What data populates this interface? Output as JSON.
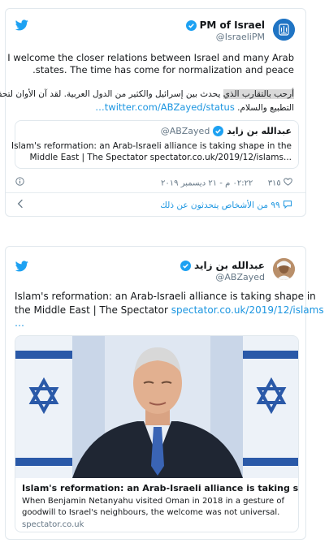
{
  "tweet1": {
    "author_name": "PM of Israel",
    "author_handle": "@IsraeliPM",
    "text_en_line1": "I welcome the closer relations between Israel and many Arab",
    "text_en_line2": ".states. The time has come for normalization and peace",
    "text_ar_line1_hl": "أرحب بالتقارب الذي",
    "text_ar_line1_rest": " يحدث بين إسرائيل والكثير من الدول العربية. لقد آن الأوان لتحقيق",
    "text_ar_line2_link": "twitter.com/ABZayed/status…",
    "text_ar_line2_rest": " التطبيع والسلام.",
    "quote": {
      "author_name": "عبدالله بن زايد",
      "author_handle": "@ABZayed",
      "text_line1": "Islam's reformation: an Arab-Israeli alliance is taking shape in the",
      "text_line2": "Middle East | The Spectator spectator.co.uk/2019/12/islams..."
    },
    "likes": "٣١٥",
    "timestamp": "٠٢:٢٢ م - ٢١ ديسمبر ٢٠١٩",
    "people_talking": "٩٩ من الأشخاص يتحدثون عن ذلك"
  },
  "tweet2": {
    "author_name": "عبدالله بن زايد",
    "author_handle": "@ABZayed",
    "text_line1": "Islam's reformation: an Arab-Israeli alliance is taking shape in",
    "text_line2_plain": "the Middle East | The Spectator ",
    "text_line2_link": "spectator.co.uk/2019/12/islams",
    "text_line3_link": "…",
    "card": {
      "title": "Islam's reformation: an Arab-Israeli alliance is taking sh...",
      "description_line1": "When Benjamin Netanyahu visited Oman in 2018 in a gesture of",
      "description_line2": "goodwill to Israel's neighbours, the welcome was not universal.",
      "domain": "spectator.co.uk"
    }
  },
  "icons": {
    "brand": "twitter-bird-icon",
    "verified": "verified-badge-icon",
    "like": "heart-icon",
    "reply": "speech-bubble-icon",
    "info": "info-icon",
    "chevron": "chevron-left-icon",
    "avatar1": "israel-emblem-avatar",
    "avatar2": "profile-photo-avatar"
  },
  "colors": {
    "twitter_blue": "#1da1f2",
    "link_blue": "#1b95e0",
    "text": "#14171a",
    "secondary_text": "#657786",
    "border": "#e1e8ed"
  }
}
